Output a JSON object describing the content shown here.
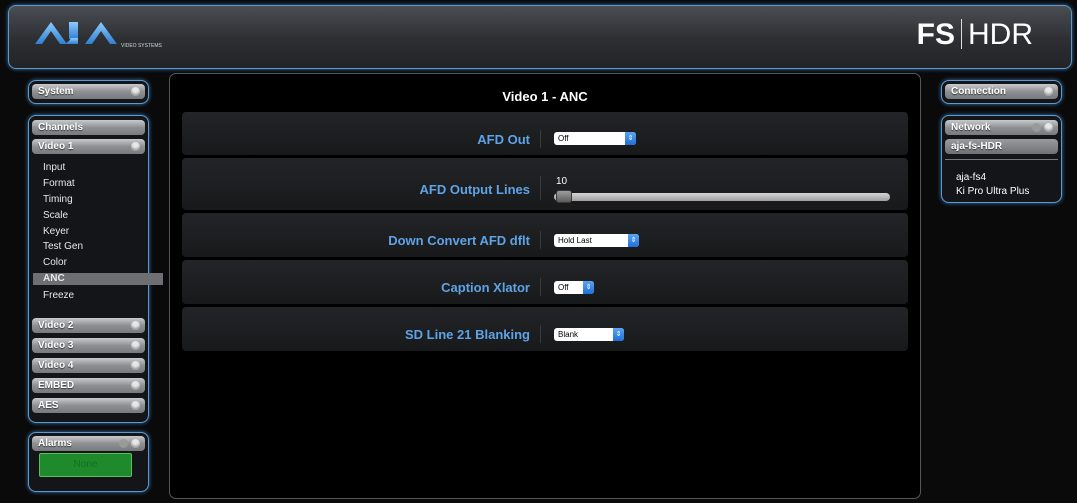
{
  "header": {
    "logo_subtext": "VIDEO SYSTEMS",
    "brand_bold": "FS",
    "brand_light": "HDR"
  },
  "left": {
    "system": "System",
    "channels": "Channels",
    "video1": "Video 1",
    "video1_items": [
      "Input",
      "Format",
      "Timing",
      "Scale",
      "Keyer",
      "Test Gen",
      "Color",
      "ANC",
      "Freeze"
    ],
    "active_item": "ANC",
    "groups": [
      "Video 2",
      "Video 3",
      "Video 4",
      "EMBED",
      "AES"
    ],
    "alarms": "Alarms",
    "alarm_status": "None"
  },
  "main": {
    "title": "Video 1 - ANC",
    "rows": [
      {
        "label": "AFD Out",
        "value": "Off"
      },
      {
        "label": "AFD Output Lines",
        "value": "10"
      },
      {
        "label": "Down Convert AFD dflt",
        "value": "Hold Last"
      },
      {
        "label": "Caption Xlator",
        "value": "Off"
      },
      {
        "label": "SD Line 21 Blanking",
        "value": "Blank"
      }
    ]
  },
  "right": {
    "connection": "Connection",
    "network": "Network",
    "current": "aja-fs-HDR",
    "devices": [
      "aja-fs4",
      "Ki Pro Ultra Plus"
    ]
  },
  "colors": {
    "accent": "#5ea3e6",
    "panel_border": "#5b9ad0",
    "alarm_green": "#1f8a2c"
  }
}
